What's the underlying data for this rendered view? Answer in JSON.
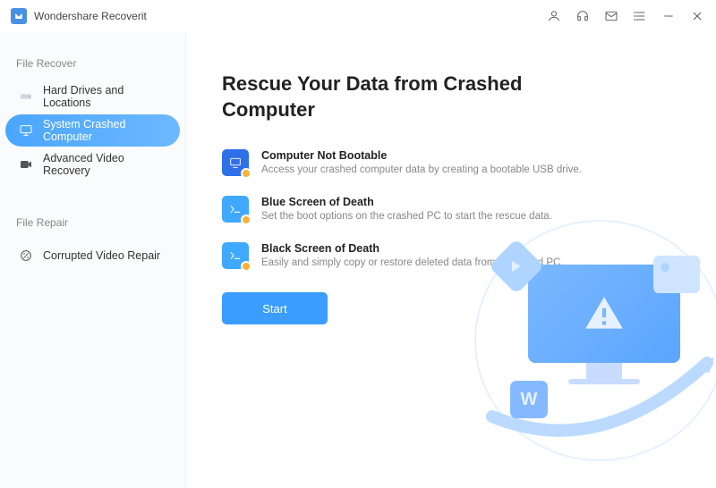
{
  "app": {
    "title": "Wondershare Recoverit"
  },
  "sidebar": {
    "section1_label": "File Recover",
    "section2_label": "File Repair",
    "items": [
      {
        "label": "Hard Drives and Locations"
      },
      {
        "label": "System Crashed Computer"
      },
      {
        "label": "Advanced Video Recovery"
      },
      {
        "label": "Corrupted Video Repair"
      }
    ]
  },
  "main": {
    "title": "Rescue Your Data from Crashed Computer",
    "features": [
      {
        "title": "Computer Not Bootable",
        "desc": "Access your crashed computer data by creating a bootable USB drive."
      },
      {
        "title": "Blue Screen of Death",
        "desc": "Set the boot options on the crashed PC to start the rescue data."
      },
      {
        "title": "Black Screen of Death",
        "desc": "Easily and simply copy or restore deleted data from a crashed PC."
      }
    ],
    "start_label": "Start"
  },
  "illustration": {
    "letter": "W"
  }
}
